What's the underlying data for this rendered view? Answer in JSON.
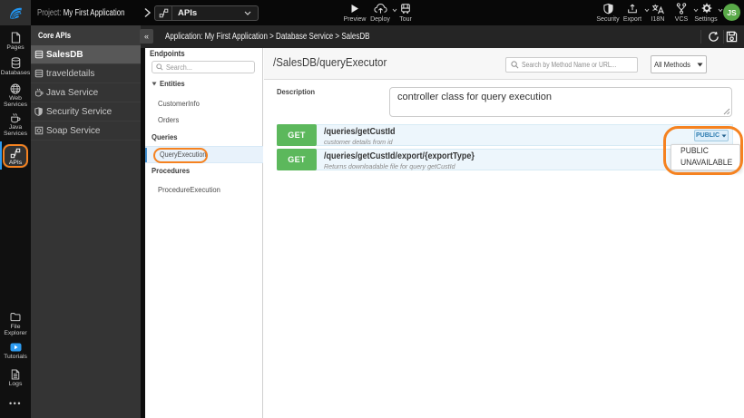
{
  "colors": {
    "accent_orange": "#f58220",
    "get_green": "#5cb85c",
    "selected_blue": "#4592d2",
    "avatar_green": "#59a948"
  },
  "topbar": {
    "logo_icon": "wavemaker-logo",
    "project_label": "Project:",
    "project_name": "My First Application",
    "nav_dropdown": {
      "label": "APIs",
      "icon": "api-nodes-icon"
    },
    "actions_left": [
      {
        "label": "Preview",
        "icon": "play-icon"
      },
      {
        "label": "Deploy",
        "icon": "cloud-upload-icon",
        "caret": true
      },
      {
        "label": "Tour",
        "icon": "bus-icon"
      }
    ],
    "actions_right": [
      {
        "label": "Security",
        "icon": "shield-icon"
      },
      {
        "label": "Export",
        "icon": "export-icon",
        "caret": true
      },
      {
        "label": "I18N",
        "icon": "translate-icon"
      },
      {
        "label": "VCS",
        "icon": "branch-icon",
        "caret": true
      },
      {
        "label": "Settings",
        "icon": "gear-icon",
        "caret": true
      }
    ],
    "avatar_initials": "JS"
  },
  "rail": {
    "items_top": [
      {
        "label": "Pages",
        "icon": "page-icon"
      },
      {
        "label": "Databases",
        "icon": "database-icon"
      },
      {
        "label": "Web Services",
        "icon": "globe-icon"
      },
      {
        "label": "Java Services",
        "icon": "coffee-icon"
      },
      {
        "label": "APIs",
        "icon": "api-nodes-icon",
        "active": true,
        "highlighted": true
      }
    ],
    "items_bottom": [
      {
        "label": "File Explorer",
        "icon": "folder-icon"
      },
      {
        "label": "Tutorials",
        "icon": "video-play-icon"
      },
      {
        "label": "Logs",
        "icon": "log-file-icon"
      }
    ],
    "overflow": "•••"
  },
  "core_apis": {
    "title": "Core APIs",
    "items": [
      {
        "label": "SalesDB",
        "icon": "database-icon",
        "selected": true
      },
      {
        "label": "traveldetails",
        "icon": "database-icon"
      },
      {
        "label": "Java Service",
        "icon": "coffee-icon"
      },
      {
        "label": "Security Service",
        "icon": "shield-icon"
      },
      {
        "label": "Soap Service",
        "icon": "soap-icon"
      }
    ]
  },
  "app_header": {
    "collapse_glyph": "«",
    "breadcrumb": "Application: My First Application > Database Service > SalesDB",
    "icons": [
      "refresh-icon",
      "save-icon"
    ]
  },
  "endpoints_panel": {
    "title": "Endpoints",
    "search_placeholder": "Search...",
    "sections": [
      {
        "header": "Entities",
        "collapsible": true,
        "items": [
          {
            "label": "CustomerInfo"
          },
          {
            "label": "Orders"
          }
        ]
      },
      {
        "header": "Queries",
        "items": [
          {
            "label": "QueryExecution",
            "selected": true,
            "highlighted": true
          }
        ]
      },
      {
        "header": "Procedures",
        "items": [
          {
            "label": "ProcedureExecution"
          }
        ]
      }
    ]
  },
  "main": {
    "title": "/SalesDB/queryExecutor",
    "search_placeholder": "Search by Method Name or URL...",
    "methods_filter": "All Methods",
    "description_label": "Description",
    "description_value": "controller class for query execution",
    "rows": [
      {
        "method": "GET",
        "path": "/queries/getCustId",
        "summary": "customer details from id",
        "access": "PUBLIC"
      },
      {
        "method": "GET",
        "path": "/queries/getCustId/export/{exportType}",
        "summary": "Returns downloadable file for query getCustId"
      }
    ],
    "access_menu": {
      "options": [
        "PUBLIC",
        "UNAVAILABLE"
      ]
    }
  }
}
